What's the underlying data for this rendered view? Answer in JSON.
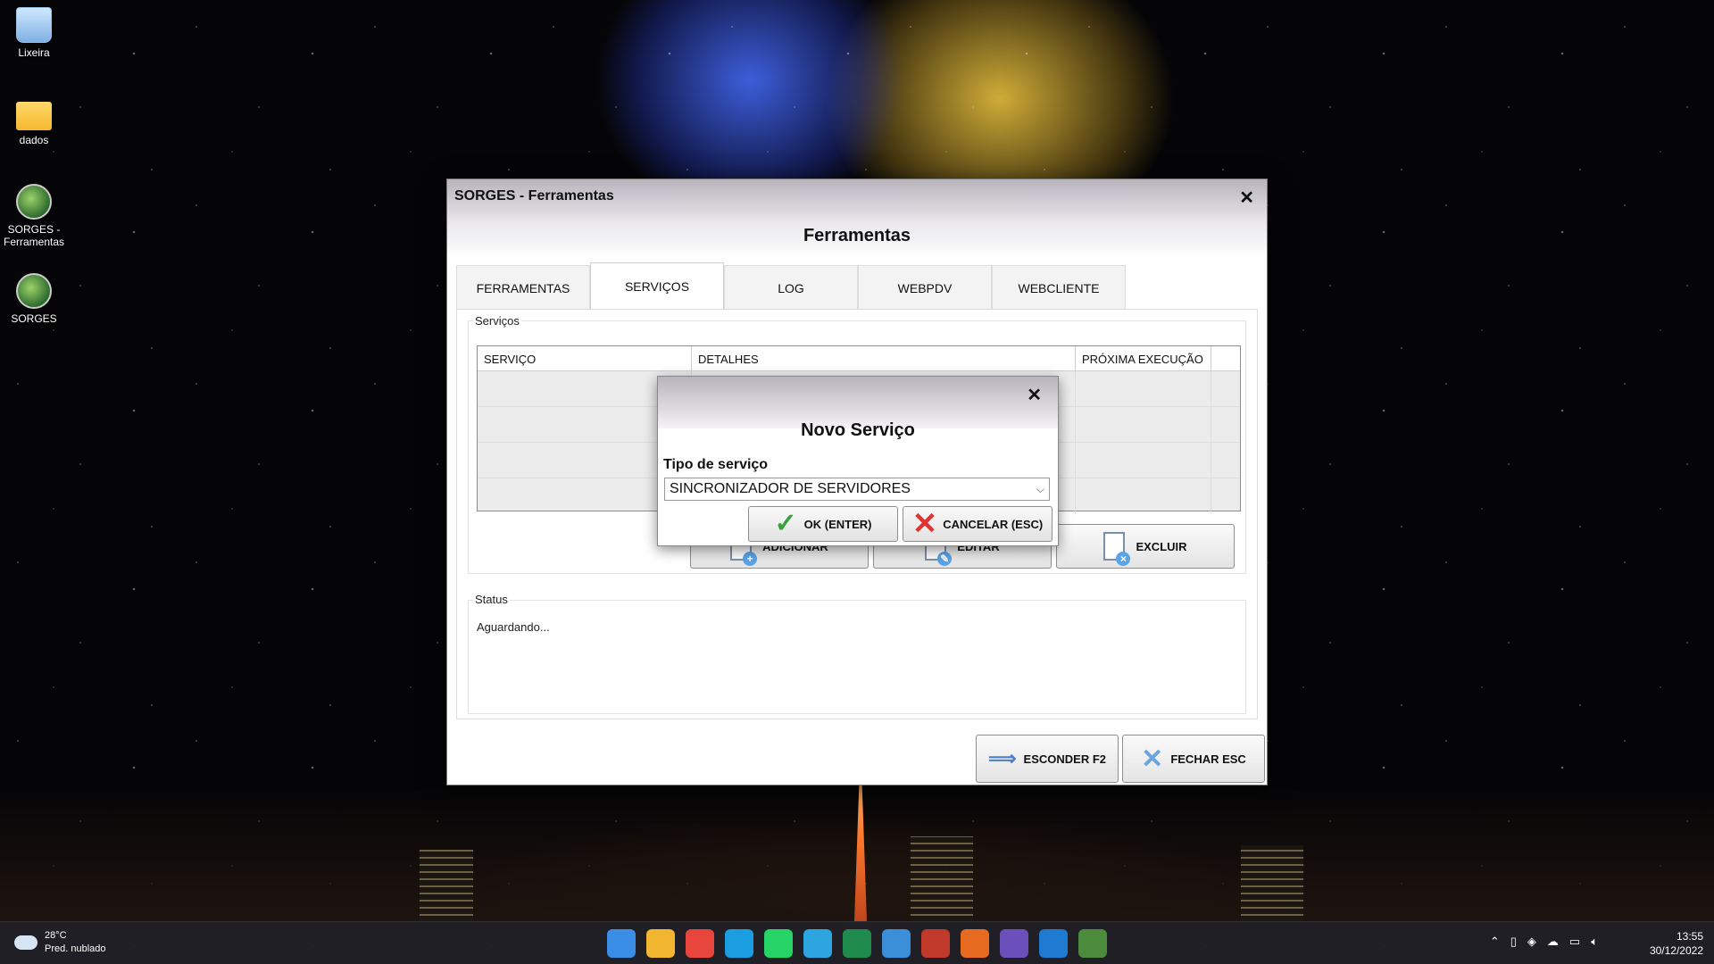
{
  "desktop": {
    "icons": [
      {
        "label": "Lixeira"
      },
      {
        "label": "dados"
      },
      {
        "label": "SORGES - Ferramentas"
      },
      {
        "label": "SORGES"
      }
    ]
  },
  "window": {
    "title": "SORGES - Ferramentas",
    "close_glyph": "✕",
    "heading": "Ferramentas",
    "tabs": [
      {
        "label": "FERRAMENTAS"
      },
      {
        "label": "SERVIÇOS",
        "active": true
      },
      {
        "label": "LOG"
      },
      {
        "label": "WEBPDV"
      },
      {
        "label": "WEBCLIENTE"
      }
    ],
    "services_group": {
      "label": "Serviços",
      "columns": [
        "SERVIÇO",
        "DETALHES",
        "PRÓXIMA EXECUÇÃO"
      ]
    },
    "action_buttons": {
      "add_label": "ADICIONAR",
      "edit_label": "EDITAR",
      "delete_label": "EXCLUIR"
    },
    "status_group": {
      "label": "Status",
      "text": "Aguardando..."
    },
    "footer": {
      "hide_label": "ESCONDER F2",
      "close_label": "FECHAR ESC"
    }
  },
  "modal": {
    "close_glyph": "✕",
    "title": "Novo Serviço",
    "field_label": "Tipo de serviço",
    "selected_value": "SINCRONIZADOR DE SERVIDORES",
    "ok_label": "OK (ENTER)",
    "cancel_label": "CANCELAR (ESC)"
  },
  "taskbar": {
    "weather_temp": "28°C",
    "weather_desc": "Pred. nublado",
    "time": "13:55",
    "date": "30/12/2022",
    "apps": [
      {
        "name": "start-icon",
        "color": "#3a8ee6"
      },
      {
        "name": "file-explorer-icon",
        "color": "#f2b630"
      },
      {
        "name": "chrome-icon",
        "color": "#e8453c"
      },
      {
        "name": "edge-icon",
        "color": "#1b9de2"
      },
      {
        "name": "whatsapp-icon",
        "color": "#25d366"
      },
      {
        "name": "telegram-icon",
        "color": "#2ca5e0"
      },
      {
        "name": "spreadsheet-icon",
        "color": "#1e8a4c"
      },
      {
        "name": "remote-desktop-icon",
        "color": "#3b8fd9"
      },
      {
        "name": "antivirus-icon",
        "color": "#c0392b"
      },
      {
        "name": "firefox-icon",
        "color": "#e66a1f"
      },
      {
        "name": "video-editor-icon",
        "color": "#6b4fbb"
      },
      {
        "name": "mail-icon",
        "color": "#1f7bd1"
      },
      {
        "name": "sorges-icon",
        "color": "#4c8a3c"
      }
    ]
  }
}
